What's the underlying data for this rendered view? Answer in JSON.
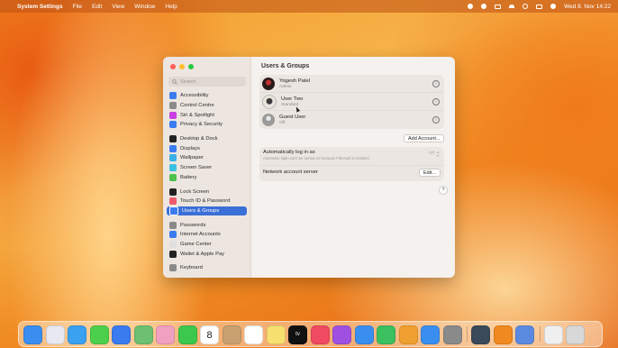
{
  "menubar": {
    "apple": "",
    "app_name": "System Settings",
    "menus": [
      "File",
      "Edit",
      "View",
      "Window",
      "Help"
    ],
    "clock": "Wed 8. Nov  14:22"
  },
  "sidebar": {
    "search_placeholder": "Search",
    "groups": [
      [
        {
          "label": "Accessibility",
          "icon": "accessibility-icon",
          "color": "#3a7bf0"
        },
        {
          "label": "Control Centre",
          "icon": "control-centre-icon",
          "color": "#8a8a8a"
        },
        {
          "label": "Siri & Spotlight",
          "icon": "siri-icon",
          "color": "#c83ee0"
        },
        {
          "label": "Privacy & Security",
          "icon": "hand-icon",
          "color": "#3a7bf0"
        }
      ],
      [
        {
          "label": "Desktop & Dock",
          "icon": "dock-icon",
          "color": "#222222"
        },
        {
          "label": "Displays",
          "icon": "display-icon",
          "color": "#3a7bf0"
        },
        {
          "label": "Wallpaper",
          "icon": "wallpaper-icon",
          "color": "#3ab0e8"
        },
        {
          "label": "Screen Saver",
          "icon": "screen-saver-icon",
          "color": "#3ac0e0"
        },
        {
          "label": "Battery",
          "icon": "battery-icon",
          "color": "#4cc24c"
        }
      ],
      [
        {
          "label": "Lock Screen",
          "icon": "lock-icon",
          "color": "#222222"
        },
        {
          "label": "Touch ID & Password",
          "icon": "fingerprint-icon",
          "color": "#f05a6a"
        },
        {
          "label": "Users & Groups",
          "icon": "users-icon",
          "color": "#3a7bf0",
          "active": true
        }
      ],
      [
        {
          "label": "Passwords",
          "icon": "key-icon",
          "color": "#8a8a8a"
        },
        {
          "label": "Internet Accounts",
          "icon": "at-icon",
          "color": "#3a7bf0"
        },
        {
          "label": "Game Center",
          "icon": "game-center-icon",
          "color": "#e0e0e0"
        },
        {
          "label": "Wallet & Apple Pay",
          "icon": "wallet-icon",
          "color": "#222222"
        }
      ],
      [
        {
          "label": "Keyboard",
          "icon": "keyboard-icon",
          "color": "#8a8a8a"
        }
      ]
    ]
  },
  "main": {
    "title": "Users & Groups",
    "users": [
      {
        "name": "Yogesh Patel",
        "role": "Admin",
        "avatar_color": "#2a1a1a"
      },
      {
        "name": "User Two",
        "role": "Standard",
        "avatar_color": "#e8e4dc"
      },
      {
        "name": "Guest User",
        "role": "Off",
        "avatar_color": "#9a9a9a"
      }
    ],
    "info_glyph": "i",
    "add_account_label": "Add Account...",
    "auto_login_label": "Automatically log in as",
    "auto_login_sub": "Automatic login can't be turned on because FileVault is enabled.",
    "auto_login_value": "Off",
    "network_server_label": "Network account server",
    "edit_label": "Edit...",
    "help_glyph": "?"
  },
  "dock": {
    "apps": [
      {
        "name": "finder-icon",
        "color": "#3a8ef0"
      },
      {
        "name": "launchpad-icon",
        "color": "#e8e8f0"
      },
      {
        "name": "safari-icon",
        "color": "#3aa0f0"
      },
      {
        "name": "messages-icon",
        "color": "#4cd04c"
      },
      {
        "name": "mail-icon",
        "color": "#3a7bf0"
      },
      {
        "name": "maps-icon",
        "color": "#6cc070"
      },
      {
        "name": "photos-icon",
        "color": "#f0a0c0"
      },
      {
        "name": "facetime-icon",
        "color": "#3cc84c"
      },
      {
        "name": "calendar-icon",
        "color": "#ffffff"
      },
      {
        "name": "contacts-icon",
        "color": "#c8a070"
      },
      {
        "name": "reminders-icon",
        "color": "#ffffff"
      },
      {
        "name": "notes-icon",
        "color": "#f8e070"
      },
      {
        "name": "tv-icon",
        "color": "#111111"
      },
      {
        "name": "music-icon",
        "color": "#f04a60"
      },
      {
        "name": "podcasts-icon",
        "color": "#a050e0"
      },
      {
        "name": "keynote-icon",
        "color": "#3a8ef0"
      },
      {
        "name": "numbers-icon",
        "color": "#3cc060"
      },
      {
        "name": "pages-icon",
        "color": "#f0a030"
      },
      {
        "name": "app-store-icon",
        "color": "#3a8ef0"
      },
      {
        "name": "system-settings-icon",
        "color": "#8a8a8a"
      },
      {
        "name": "quicktime-icon",
        "color": "#3a4a5a"
      },
      {
        "name": "vlc-icon",
        "color": "#f08a20"
      },
      {
        "name": "preview-icon",
        "color": "#5a8ae0"
      },
      {
        "name": "document-icon",
        "color": "#f0f0f0"
      },
      {
        "name": "trash-icon",
        "color": "#d8d8d8"
      }
    ],
    "calendar_day": "8",
    "tv_label": "tv"
  }
}
